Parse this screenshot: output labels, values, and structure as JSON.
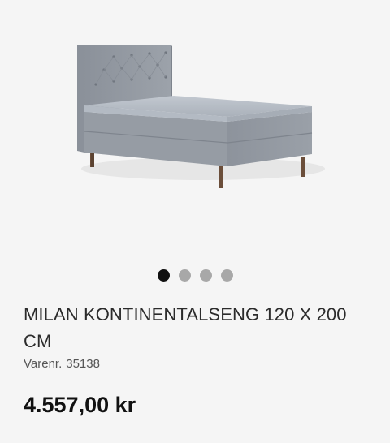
{
  "product": {
    "title": "MILAN KONTINENTALSENG 120 X 200 CM",
    "sku_label": "Varenr.",
    "sku": "35138",
    "price": "4.557,00 kr"
  },
  "gallery": {
    "image_count": 4,
    "active_index": 0
  },
  "colors": {
    "active_dot": "#111111",
    "inactive_dot": "#a8a8a8",
    "background": "#f5f5f5"
  }
}
